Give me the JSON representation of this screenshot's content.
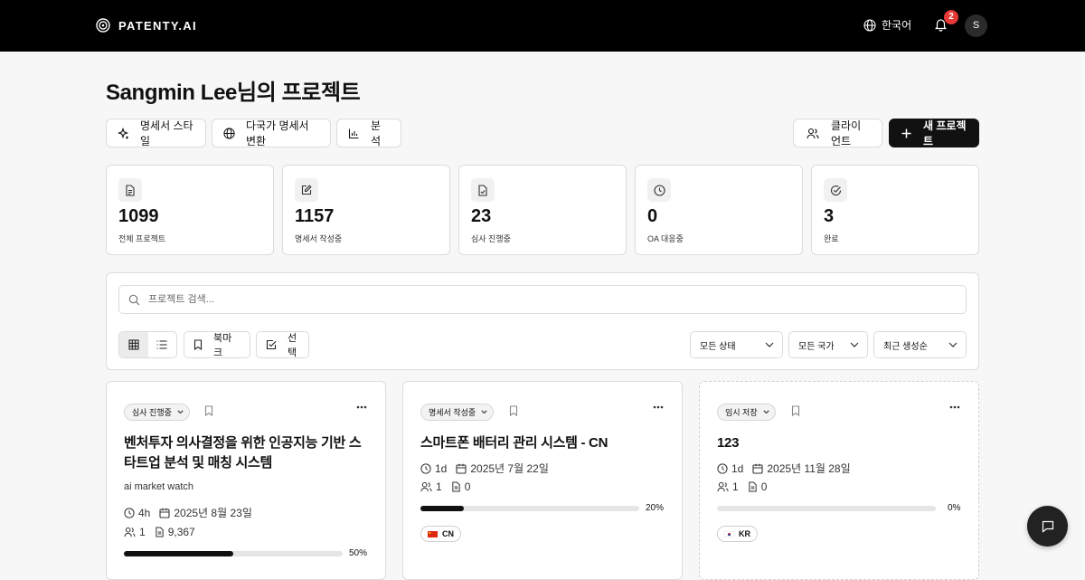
{
  "header": {
    "brand": "PATENTY.AI",
    "language": "한국어",
    "notification_count": "2",
    "avatar_initial": "S"
  },
  "page_title": "Sangmin Lee님의 프로젝트",
  "toolbar": {
    "spec_style": "명세서 스타일",
    "multi_country": "다국가 명세서 변환",
    "analysis": "분석",
    "client": "클라이언트",
    "new_project": "새 프로젝트"
  },
  "stats": [
    {
      "value": "1099",
      "label": "전체 프로젝트",
      "icon": "document-icon"
    },
    {
      "value": "1157",
      "label": "명세서 작성중",
      "icon": "edit-icon"
    },
    {
      "value": "23",
      "label": "심사 진행중",
      "icon": "file-check-icon"
    },
    {
      "value": "0",
      "label": "OA 대응중",
      "icon": "clock-icon"
    },
    {
      "value": "3",
      "label": "완료",
      "icon": "check-circle-icon"
    }
  ],
  "search": {
    "placeholder": "프로젝트 검색..."
  },
  "filters": {
    "bookmark": "북마크",
    "select": "선택",
    "status": "모든 상태",
    "country": "모든 국가",
    "sort": "최근 생성순"
  },
  "projects": [
    {
      "status": "심사 진행중",
      "title": "벤처투자 의사결정을 위한 인공지능 기반 스타트업 분석 및 매칭 시스템",
      "subtitle": "ai market watch",
      "age": "4h",
      "date": "2025년 8월 23일",
      "members": "1",
      "docs": "9,367",
      "progress": 0.5,
      "progress_label": "50%"
    },
    {
      "status": "명세서 작성중",
      "title": "스마트폰 배터리 관리 시스템 - CN",
      "age": "1d",
      "date": "2025년 7월 22일",
      "members": "1",
      "docs": "0",
      "progress": 0.2,
      "progress_label": "20%",
      "country": "CN"
    },
    {
      "status": "임시 저장",
      "title": "123",
      "age": "1d",
      "date": "2025년 11월 28일",
      "members": "1",
      "docs": "0",
      "progress": 0.0,
      "progress_label": "0%",
      "country": "KR"
    }
  ],
  "colors": {
    "header_bg": "#000000",
    "badge": "#e53935",
    "progress_fill": "#111111"
  }
}
